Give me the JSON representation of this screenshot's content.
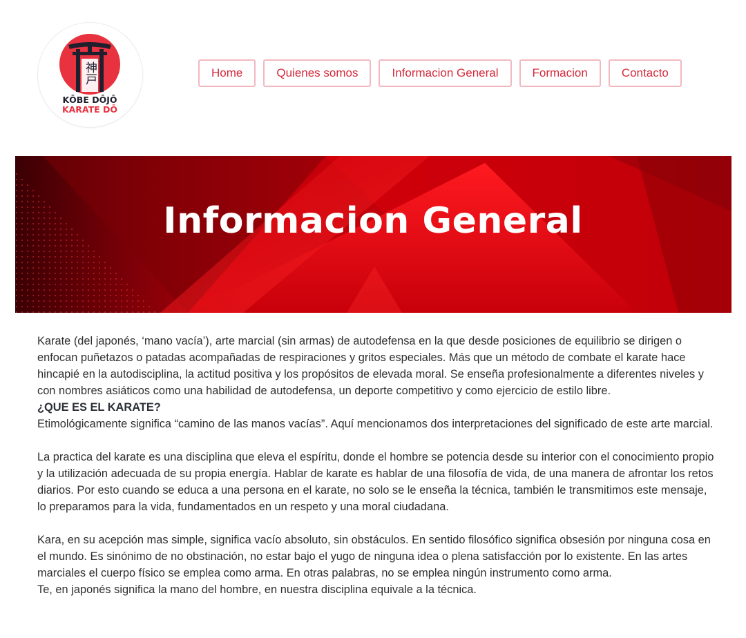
{
  "logo": {
    "kanji": "神戸",
    "line1": "KŌBE DŌJŌ",
    "line2": "KARATE DŌ"
  },
  "nav": {
    "items": [
      {
        "label": "Home"
      },
      {
        "label": "Quienes somos"
      },
      {
        "label": "Informacion General"
      },
      {
        "label": "Formacion"
      },
      {
        "label": "Contacto"
      }
    ]
  },
  "banner": {
    "title": "Informacion General"
  },
  "content": {
    "intro": "Karate (del japonés, ‘mano vacía’), arte marcial (sin armas) de autodefensa en la que desde posiciones de equilibrio se dirigen o enfocan puñetazos o patadas acompañadas de respiraciones y gritos especiales. Más que un método de combate el karate hace hincapié en la autodisciplina, la actitud positiva y los propósitos de elevada moral. Se enseña profesionalmente a diferentes niveles y con nombres asiáticos como una habilidad de autodefensa, un deporte competitivo y como ejercicio de estilo libre.",
    "heading": "¿QUE ES EL KARATE?",
    "etymology": "Etimológicamente significa “camino de las manos vacías”. Aquí mencionamos dos interpretaciones del significado de este arte marcial.",
    "practice": "La practica del karate es una disciplina que eleva el espíritu, donde el hombre se potencia desde su interior con el conocimiento propio y la utilización adecuada de su propia energía. Hablar de karate es hablar de una filosofía de vida, de una manera de afrontar los retos diarios. Por esto cuando se educa a una persona en el karate, no solo se le enseña la técnica, también le transmitimos este mensaje, lo preparamos para la vida, fundamentados en un respeto y una moral ciudadana.",
    "kara": "Kara, en su acepción mas simple, significa vacío absoluto, sin obstáculos. En sentido filosófico significa obsesión por ninguna cosa en el mundo. Es sinónimo de no obstinación, no estar bajo el yugo de ninguna idea o plena satisfacción por lo existente. En las artes marciales el cuerpo físico se emplea como arma. En otras palabras, no se emplea ningún instrumento como arma.",
    "te": "Te, en japonés significa la mano del hombre, en nuestra disciplina equivale a la técnica."
  },
  "colors": {
    "accent": "#d42a3c",
    "nav_border": "#f2b8c0",
    "banner_red": "#e00a12"
  }
}
